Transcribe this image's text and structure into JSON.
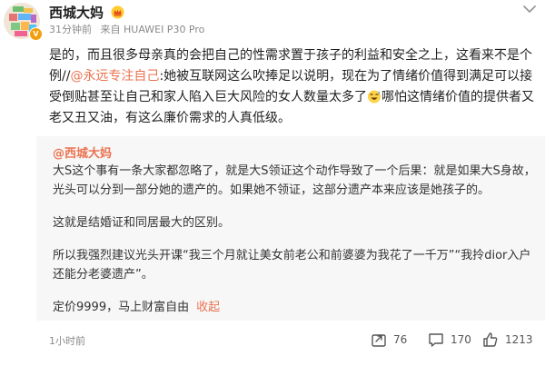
{
  "user": {
    "name": "西城大妈",
    "time": "31分钟前",
    "source": "来自 HUAWEI P30 Pro"
  },
  "post": {
    "seg1": "是的，而且很多母亲真的会把自己的性需求置于孩子的利益和安全之上，这看来不是个例//",
    "mention": "@永远专注自己",
    "seg2": ":她被互联网这么吹捧足以说明，现在为了情绪价值得到满足可以接受倒贴甚至让自己和家人陷入巨大风险的女人数量太多了",
    "seg3": "哪怕这情绪价值的提供者又老又丑又油，有这么廉价需求的人真低级。"
  },
  "quote": {
    "author": "@西城大妈",
    "p1": "大S这个事有一条大家都忽略了，就是大S领证这个动作导致了一个后果：就是如果大S身故，光头可以分到一部分她的遗产的。如果她不领证，这部分遗产本来应该是她孩子的。",
    "p2": "这就是结婚证和同居最大的区别。",
    "p3": "所以我强烈建议光头开课“我三个月就让美女前老公和前婆婆为我花了一千万”“我拎dior入户还能分老婆遗产”。",
    "p4": "定价9999，马上财富自由",
    "p4_link": "收起"
  },
  "footer": {
    "time": "1小时前",
    "reposts": "76",
    "comments": "170",
    "likes": "1213"
  },
  "icons": {
    "vip": "crown-badge-icon",
    "emoji": "sweat-smile-emoji-icon",
    "repost": "repost-icon",
    "comment": "comment-icon",
    "like": "thumbs-up-icon",
    "more": "chevron-down-icon"
  },
  "colors": {
    "link": "#eb7350",
    "quote_bg": "#f7f7f7",
    "meta": "#8a8a8a"
  }
}
